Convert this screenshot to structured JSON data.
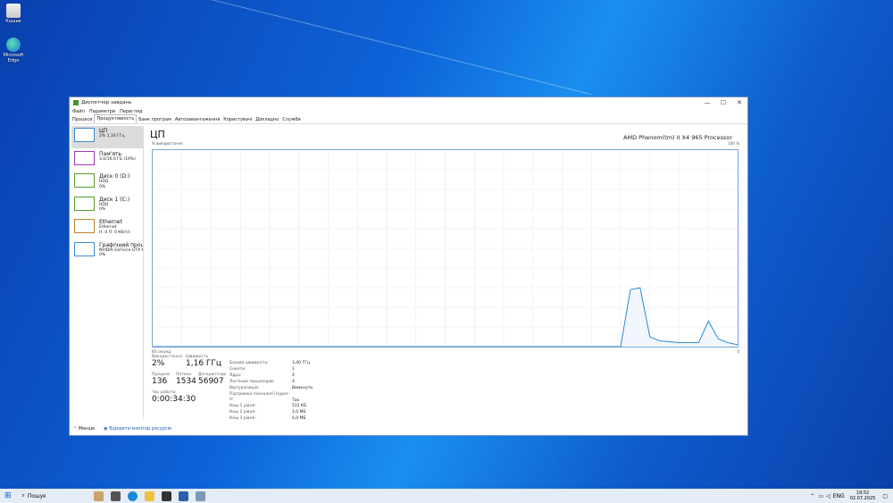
{
  "desktop": {
    "icons": [
      {
        "label": "Кошик"
      },
      {
        "label": "Microsoft Edge"
      }
    ]
  },
  "window": {
    "title": "Диспетчер завдань",
    "controls": {
      "minimize": "—",
      "maximize": "☐",
      "close": "✕"
    },
    "menu": [
      "Файл",
      "Параметри",
      "Перегляд"
    ],
    "tabs": [
      "Процеси",
      "Продуктивність",
      "Банк програм",
      "Автозавантаження",
      "Користувачі",
      "Докладно",
      "Служби"
    ],
    "active_tab": "Продуктивність"
  },
  "sidebar": [
    {
      "name": "ЦП",
      "line1": "2% 1,16 ГГц",
      "line2": "",
      "color": "#3c8bd1"
    },
    {
      "name": "Пам'ять",
      "line1": "3,0/16,0 ГБ (19%)",
      "line2": "",
      "color": "#9c3bb5"
    },
    {
      "name": "Диск 0 (D:)",
      "line1": "HDD",
      "line2": "0%",
      "color": "#5a9e2c"
    },
    {
      "name": "Диск 1 (C:)",
      "line1": "HDD",
      "line2": "0%",
      "color": "#5a9e2c"
    },
    {
      "name": "Ethernet",
      "line1": "Ethernet",
      "line2": "Н: 0 П: 0 Кбіт/с",
      "color": "#b8832a"
    },
    {
      "name": "Графічний процес",
      "line1": "NVIDIA GeForce GTX 660",
      "line2": "0%",
      "color": "#3c8bd1"
    }
  ],
  "main": {
    "title": "ЦП",
    "model": "AMD Phenom(tm) II X4 965 Processor",
    "y_label": "% використання",
    "y_max": "100 %",
    "x_label": "60 секунд",
    "x_min": "0",
    "stats": {
      "usage_label": "Використання",
      "usage": "2%",
      "speed_label": "Швидкість",
      "speed": "1,16 ГГц",
      "proc_label": "Процеси",
      "proc": "136",
      "threads_label": "Потоки",
      "threads": "1534",
      "handles_label": "Дескриптори",
      "handles": "56907",
      "uptime_label": "Час роботи",
      "uptime": "0:00:34:30"
    },
    "info": [
      {
        "k": "Базова швидкість:",
        "v": "3,40 ГГц"
      },
      {
        "k": "Сокети:",
        "v": "1"
      },
      {
        "k": "Ядра:",
        "v": "4"
      },
      {
        "k": "Логічних процесорів:",
        "v": "4"
      },
      {
        "k": "Віртуалізація:",
        "v": "Вимкнуто"
      },
      {
        "k": "Підтримка технології Hyper-V:",
        "v": "Так"
      },
      {
        "k": "Кеш 1 рівня:",
        "v": "512 КБ"
      },
      {
        "k": "Кеш 2 рівня:",
        "v": "2,0 МБ"
      },
      {
        "k": "Кеш 3 рівня:",
        "v": "6,0 МБ"
      }
    ]
  },
  "chart_data": {
    "type": "area",
    "x": [
      60,
      55,
      50,
      45,
      40,
      35,
      30,
      25,
      20,
      15,
      12,
      11,
      10,
      9,
      8,
      6,
      4,
      3,
      2,
      1,
      0
    ],
    "values": [
      0,
      0,
      0,
      0,
      0,
      0,
      0,
      0,
      0,
      0,
      0,
      29,
      30,
      5,
      3,
      2,
      2,
      13,
      4,
      2,
      1
    ],
    "ylim": [
      0,
      100
    ]
  },
  "footer": {
    "less": "Менше",
    "monitor": "Відкрити монітор ресурсів"
  },
  "taskbar": {
    "search": "Пошук",
    "lang": "ENG",
    "time": "19:52",
    "date": "02.07.2025"
  }
}
